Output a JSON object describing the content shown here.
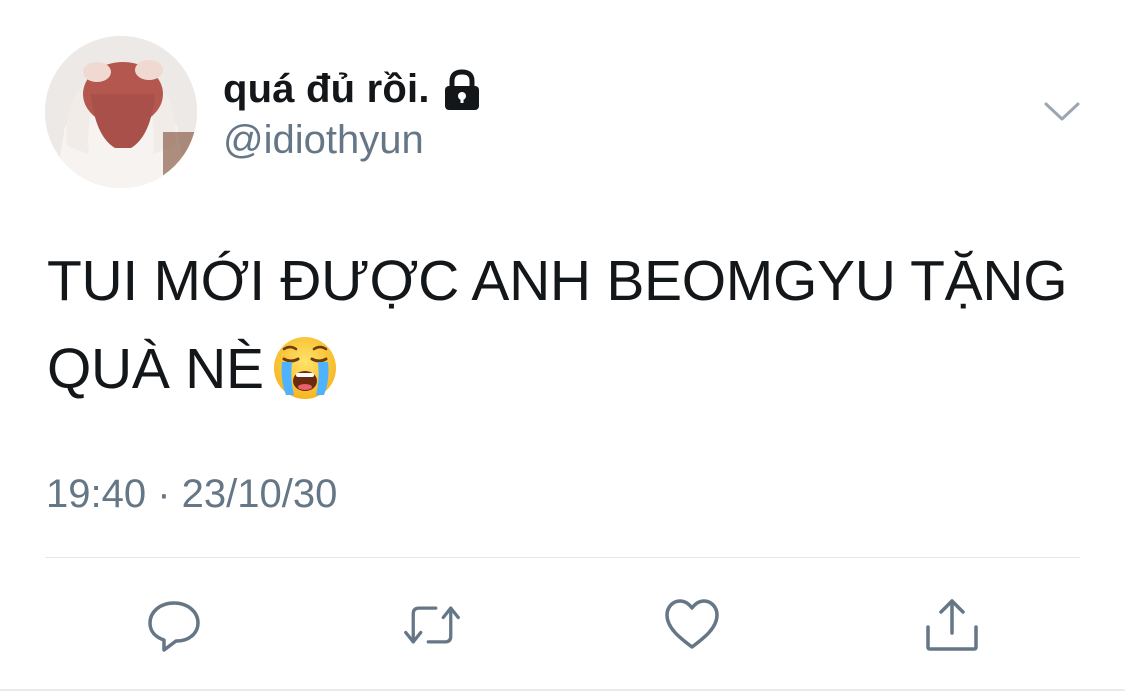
{
  "user": {
    "display_name": "quá đủ rồi.",
    "handle": "@idiothyun",
    "protected_icon": "lock-icon",
    "avatar": "profile-photo"
  },
  "tweet": {
    "text": "TUI MỚI ĐƯỢC ANH BEOMGYU TẶNG QUÀ NÈ",
    "emoji": "loudly-crying-face-emoji",
    "timestamp": "19:40 · 23/10/30"
  },
  "actions": [
    {
      "name": "reply",
      "icon": "reply-icon"
    },
    {
      "name": "retweet",
      "icon": "retweet-icon"
    },
    {
      "name": "like",
      "icon": "heart-icon"
    },
    {
      "name": "share",
      "icon": "share-icon"
    }
  ],
  "colors": {
    "text_primary": "#14171a",
    "text_secondary": "#657786",
    "icon": "#657786",
    "divider": "#e1e8ed"
  }
}
